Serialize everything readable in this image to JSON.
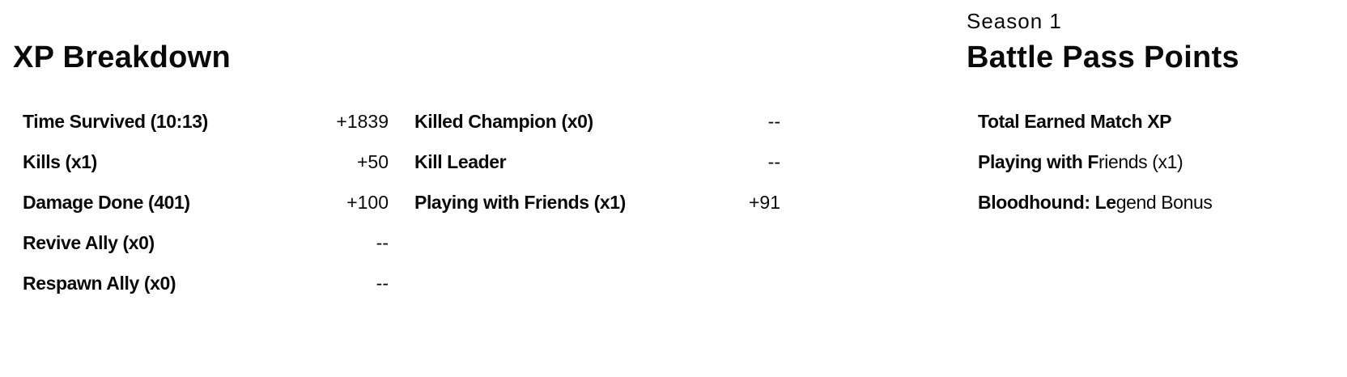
{
  "xp_breakdown": {
    "title": "XP Breakdown",
    "left_rows": [
      {
        "label": "Time Survived (10:13)",
        "value": "+1839"
      },
      {
        "label": "Kills (x1)",
        "value": "+50"
      },
      {
        "label": "Damage Done (401)",
        "value": "+100"
      },
      {
        "label": "Revive Ally (x0)",
        "value": "--"
      },
      {
        "label": "Respawn Ally (x0)",
        "value": "--"
      }
    ],
    "right_rows": [
      {
        "label": "Killed Champion (x0)",
        "value": "--"
      },
      {
        "label": "Kill Leader",
        "value": "--"
      },
      {
        "label": "Playing with Friends (x1)",
        "value": "+91"
      }
    ]
  },
  "battle_pass": {
    "season": "Season 1",
    "title": "Battle Pass Points",
    "rows": [
      {
        "label": "Total Earned Match XP"
      },
      {
        "label": "Playing with F",
        "label_thin": "riends (x1)"
      },
      {
        "label": "Bloodhound: Le",
        "label_thin": "gend Bonus"
      }
    ]
  }
}
